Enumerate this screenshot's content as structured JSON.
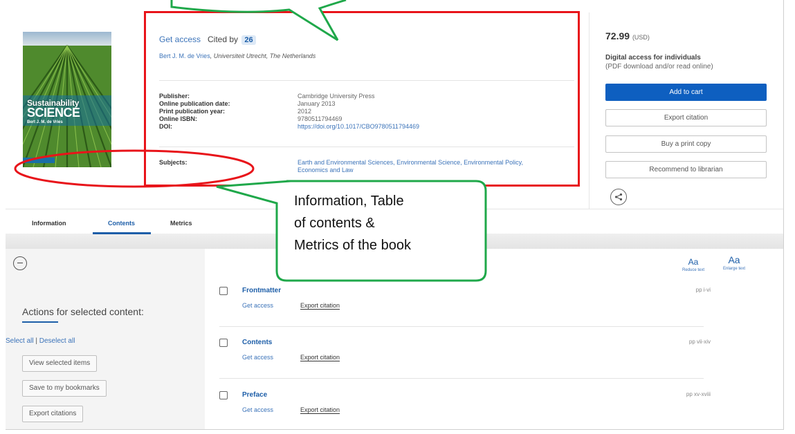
{
  "book": {
    "cover": {
      "title_line1": "Sustainability",
      "title_line2": "SCIENCE",
      "author": "Bert J. M. de Vries"
    },
    "get_access": "Get access",
    "cited_by_label": "Cited by",
    "cited_by_count": "26",
    "author_name": "Bert J. M. de Vries",
    "author_affiliation": ", Universiteit Utrecht, The Netherlands",
    "details": [
      {
        "label": "Publisher:",
        "value": "Cambridge University Press"
      },
      {
        "label": "Online publication date:",
        "value": "January 2013"
      },
      {
        "label": "Print publication year:",
        "value": "2012"
      },
      {
        "label": "Online ISBN:",
        "value": "9780511794469"
      },
      {
        "label": "DOI:",
        "value": "https://doi.org/10.1017/CBO9780511794469"
      }
    ],
    "subjects_label": "Subjects:",
    "subjects_line1": "Earth and Environmental Sciences, Environmental Science, Environmental Policy,",
    "subjects_line2": "Economics and Law"
  },
  "purchase": {
    "price": "72.99",
    "currency": "(USD)",
    "access_title": "Digital access for individuals",
    "access_sub": "(PDF download and/or read online)",
    "add_to_cart": "Add to cart",
    "export_citation": "Export citation",
    "buy_print": "Buy a print copy",
    "recommend": "Recommend to librarian"
  },
  "tabs": [
    {
      "label": "Information"
    },
    {
      "label": "Contents"
    },
    {
      "label": "Metrics"
    }
  ],
  "active_tab": "Contents",
  "sidebar": {
    "actions_title": "Actions for selected content:",
    "select_all": "Select all",
    "separator": "|",
    "deselect_all": "Deselect all",
    "view_selected": "View selected items",
    "save_bookmarks": "Save to my bookmarks",
    "export_citations": "Export citations"
  },
  "text_size": {
    "reduce_glyph": "Aa",
    "reduce_label": "Reduce text",
    "enlarge_glyph": "Aa",
    "enlarge_label": "Enlarge text"
  },
  "contents": [
    {
      "title": "Frontmatter",
      "get_access": "Get access",
      "export": "Export citation",
      "pages": "pp i-vi"
    },
    {
      "title": "Contents",
      "get_access": "Get access",
      "export": "Export citation",
      "pages": "pp vii-xiv"
    },
    {
      "title": "Preface",
      "get_access": "Get access",
      "export": "Export citation",
      "pages": "pp xv-xviii"
    }
  ],
  "annotation": {
    "callout_line1": "Information, Table",
    "callout_line2": "of contents &",
    "callout_line3": "Metrics of the book",
    "colors": {
      "box": "#e8141a",
      "callout": "#1fa84a"
    }
  }
}
